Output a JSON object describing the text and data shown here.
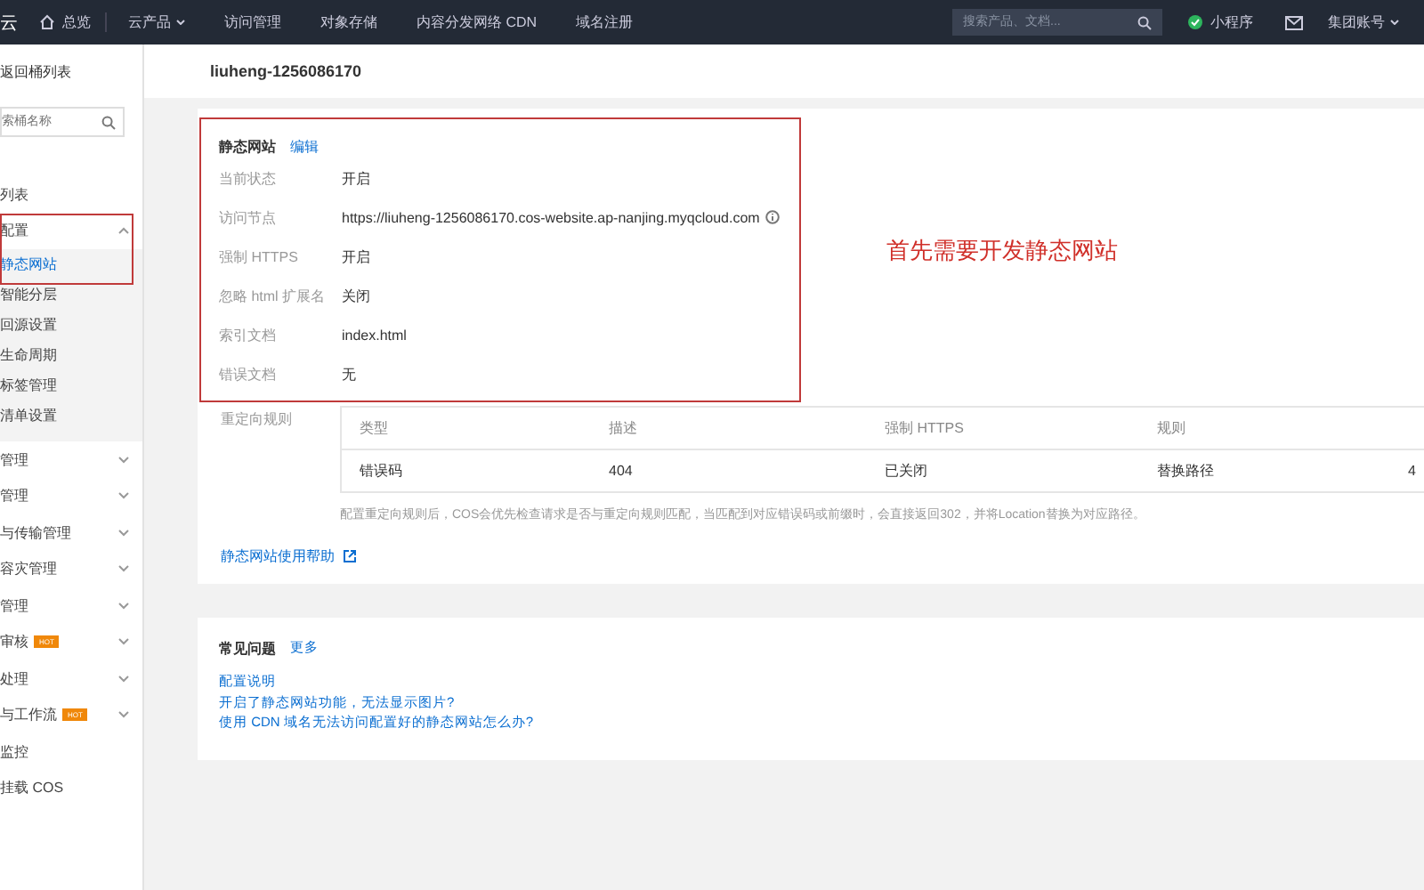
{
  "topbar": {
    "logo": "云",
    "home": "总览",
    "menu": [
      {
        "label": "云产品",
        "dropdown": true
      },
      {
        "label": "访问管理",
        "dropdown": false
      },
      {
        "label": "对象存储",
        "dropdown": false
      },
      {
        "label": "内容分发网络 CDN",
        "dropdown": false
      },
      {
        "label": "域名注册",
        "dropdown": false
      }
    ],
    "search": {
      "placeholder": "搜索产品、文档..."
    },
    "mini_program": "小程序",
    "account": "集团账号"
  },
  "sidebar": {
    "back": "返回桶列表",
    "search": {
      "placeholder": "索桶名称"
    },
    "items": [
      {
        "label": "列表",
        "selected": false
      },
      {
        "label": "配置",
        "selected": false,
        "expanded": true,
        "children": [
          {
            "label": "静态网站",
            "selected": true
          },
          {
            "label": "智能分层",
            "selected": false
          },
          {
            "label": "回源设置",
            "selected": false
          },
          {
            "label": "生命周期",
            "selected": false
          },
          {
            "label": "标签管理",
            "selected": false
          },
          {
            "label": "清单设置",
            "selected": false
          }
        ]
      },
      {
        "label": "管理",
        "selected": false,
        "expanded": false
      },
      {
        "label": "管理",
        "selected": false,
        "expanded": false
      },
      {
        "label": "与传输管理",
        "selected": false,
        "expanded": false
      },
      {
        "label": "容灾管理",
        "selected": false,
        "expanded": false
      },
      {
        "label": "管理",
        "selected": false,
        "expanded": false
      },
      {
        "label": "审核",
        "selected": false,
        "expanded": false,
        "badge": "HOT"
      },
      {
        "label": "处理",
        "selected": false,
        "expanded": false
      },
      {
        "label": "与工作流",
        "selected": false,
        "expanded": false,
        "badge": "HOT"
      },
      {
        "label": "监控",
        "selected": false
      },
      {
        "label": "挂载 COS",
        "selected": false
      }
    ]
  },
  "header": {
    "title": "liuheng-1256086170"
  },
  "static_website": {
    "title": "静态网站",
    "edit": "编辑",
    "fields": [
      {
        "label": "当前状态",
        "value": "开启"
      },
      {
        "label": "访问节点",
        "value": "https://liuheng-1256086170.cos-website.ap-nanjing.myqcloud.com",
        "info": true
      },
      {
        "label": "强制 HTTPS",
        "value": "开启"
      },
      {
        "label": "忽略 html 扩展名",
        "value": "关闭"
      },
      {
        "label": "索引文档",
        "value": "index.html"
      },
      {
        "label": "错误文档",
        "value": "无"
      }
    ],
    "annotation": "首先需要开发静态网站",
    "redirect_label": "重定向规则",
    "table": {
      "columns": [
        "类型",
        "描述",
        "强制 HTTPS",
        "规则"
      ],
      "rows": [
        [
          "错误码",
          "404",
          "已关闭",
          "替换路径",
          "4"
        ]
      ]
    },
    "note": "配置重定向规则后，COS会优先检查请求是否与重定向规则匹配，当匹配到对应错误码或前缀时，会直接返回302，并将Location替换为对应路径。",
    "help_link": "静态网站使用帮助"
  },
  "faq": {
    "title": "常见问题",
    "more": "更多",
    "links": [
      "配置说明",
      "开启了静态网站功能，无法显示图片?",
      "使用 CDN 域名无法访问配置好的静态网站怎么办?"
    ]
  }
}
